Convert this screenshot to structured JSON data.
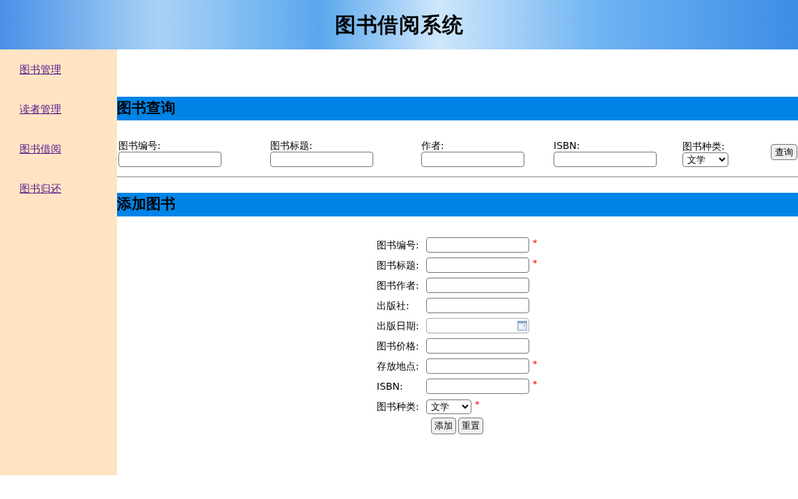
{
  "header": {
    "title": "图书借阅系统"
  },
  "sidebar": {
    "items": [
      {
        "label": "图书管理"
      },
      {
        "label": "读者管理"
      },
      {
        "label": "图书借阅"
      },
      {
        "label": "图书归还"
      }
    ]
  },
  "search": {
    "heading": "图书查询",
    "fields": [
      {
        "kind": "text",
        "label": "图书编号:"
      },
      {
        "kind": "text",
        "label": "图书标题:"
      },
      {
        "kind": "text",
        "label": "作者:"
      },
      {
        "kind": "text",
        "label": "ISBN:"
      },
      {
        "kind": "select",
        "label": "图书种类:",
        "value": "文学"
      }
    ],
    "button": "查询"
  },
  "add": {
    "heading": "添加图书",
    "required_mark": "*",
    "fields": [
      {
        "kind": "text",
        "label": "图书编号:",
        "required": true
      },
      {
        "kind": "text",
        "label": "图书标题:",
        "required": true
      },
      {
        "kind": "text",
        "label": "图书作者:",
        "required": false
      },
      {
        "kind": "text",
        "label": "出版社:",
        "required": false
      },
      {
        "kind": "date",
        "label": "出版日期:",
        "required": false
      },
      {
        "kind": "text",
        "label": "图书价格:",
        "required": false
      },
      {
        "kind": "text",
        "label": "存放地点:",
        "required": true
      },
      {
        "kind": "text",
        "label": "ISBN:",
        "required": true
      },
      {
        "kind": "select",
        "label": "图书种类:",
        "value": "文学",
        "required": true
      }
    ],
    "buttons": [
      "添加",
      "重置"
    ]
  }
}
